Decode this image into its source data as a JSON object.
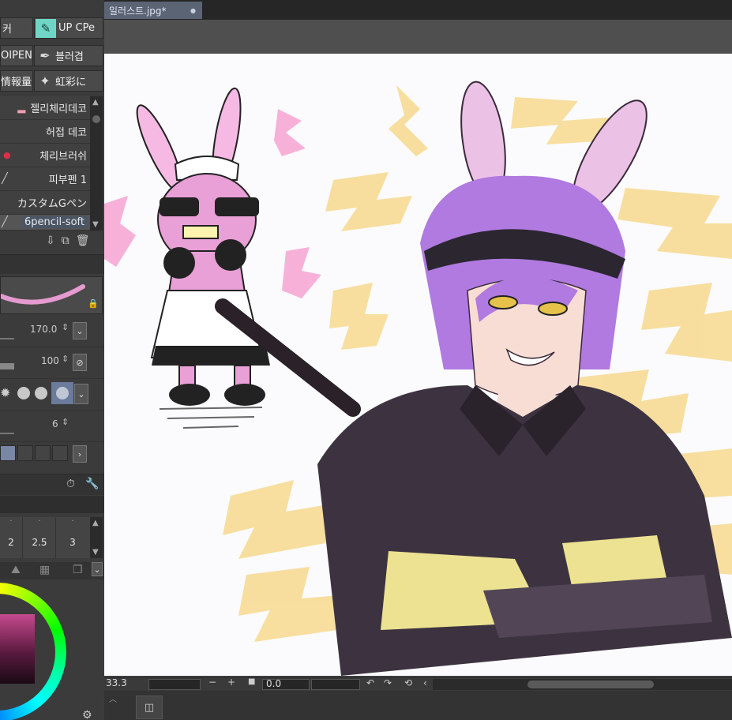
{
  "document": {
    "tab_title": "일러스트.jpg*",
    "close_symbol": "●"
  },
  "brush_buttons": [
    {
      "label": "커"
    },
    {
      "label": "UP CPe"
    },
    {
      "label": "OIPEN"
    },
    {
      "label": "블러겹"
    },
    {
      "label": "情報量"
    },
    {
      "label": "虹彩に"
    }
  ],
  "brush_list": [
    {
      "label": "젤리체리데코"
    },
    {
      "label": "허접 데코"
    },
    {
      "label": "체리브러쉬"
    },
    {
      "label": "피부펜 1"
    },
    {
      "label": "カスタムGペン"
    },
    {
      "label": "6pencil-soft"
    }
  ],
  "tool_properties": {
    "brush_size": "170.0",
    "opacity": "100",
    "stabilization": "6"
  },
  "stabilizer_ticks": [
    "2",
    "2.5",
    "3"
  ],
  "status": {
    "zoom": "33.3",
    "rotation": "0.0"
  },
  "colors": {
    "accent": "#5a6474",
    "canvas_bg": "#fbfbfd",
    "panel_bg": "#3b3b3b",
    "selected_brush_icon": "#6fd6c6"
  }
}
